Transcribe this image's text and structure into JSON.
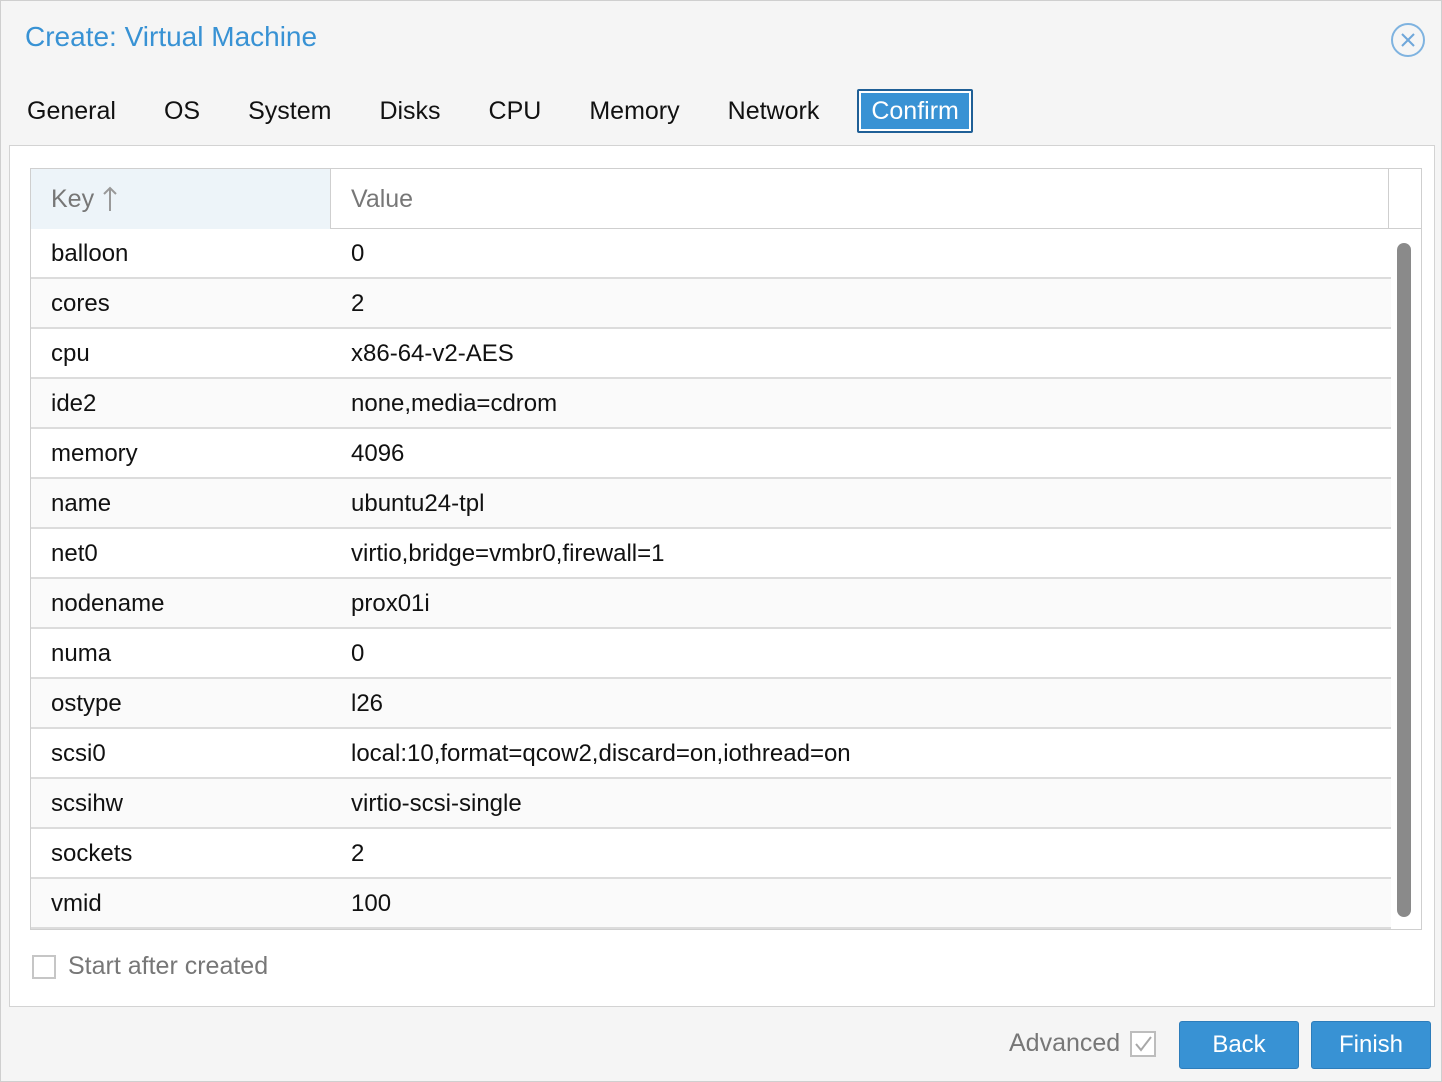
{
  "dialog": {
    "title": "Create: Virtual Machine"
  },
  "tabs": [
    {
      "label": "General",
      "active": false
    },
    {
      "label": "OS",
      "active": false
    },
    {
      "label": "System",
      "active": false
    },
    {
      "label": "Disks",
      "active": false
    },
    {
      "label": "CPU",
      "active": false
    },
    {
      "label": "Memory",
      "active": false
    },
    {
      "label": "Network",
      "active": false
    },
    {
      "label": "Confirm",
      "active": true
    }
  ],
  "grid": {
    "columns": {
      "key": "Key",
      "value": "Value"
    },
    "sort": "ascending",
    "rows": [
      {
        "key": "balloon",
        "value": "0"
      },
      {
        "key": "cores",
        "value": "2"
      },
      {
        "key": "cpu",
        "value": "x86-64-v2-AES"
      },
      {
        "key": "ide2",
        "value": "none,media=cdrom"
      },
      {
        "key": "memory",
        "value": "4096"
      },
      {
        "key": "name",
        "value": "ubuntu24-tpl"
      },
      {
        "key": "net0",
        "value": "virtio,bridge=vmbr0,firewall=1"
      },
      {
        "key": "nodename",
        "value": "prox01i"
      },
      {
        "key": "numa",
        "value": "0"
      },
      {
        "key": "ostype",
        "value": "l26"
      },
      {
        "key": "scsi0",
        "value": "local:10,format=qcow2,discard=on,iothread=on"
      },
      {
        "key": "scsihw",
        "value": "virtio-scsi-single"
      },
      {
        "key": "sockets",
        "value": "2"
      },
      {
        "key": "vmid",
        "value": "100"
      }
    ]
  },
  "start_after_created": {
    "label": "Start after created",
    "checked": false
  },
  "footer": {
    "advanced_label": "Advanced",
    "advanced_checked": true,
    "back_label": "Back",
    "finish_label": "Finish"
  },
  "colors": {
    "accent": "#3892d4",
    "header_key_bg": "#edf4f9"
  },
  "icons": {
    "close": "close-circle-icon",
    "sort": "arrow-up-icon",
    "check": "checkmark-icon"
  }
}
